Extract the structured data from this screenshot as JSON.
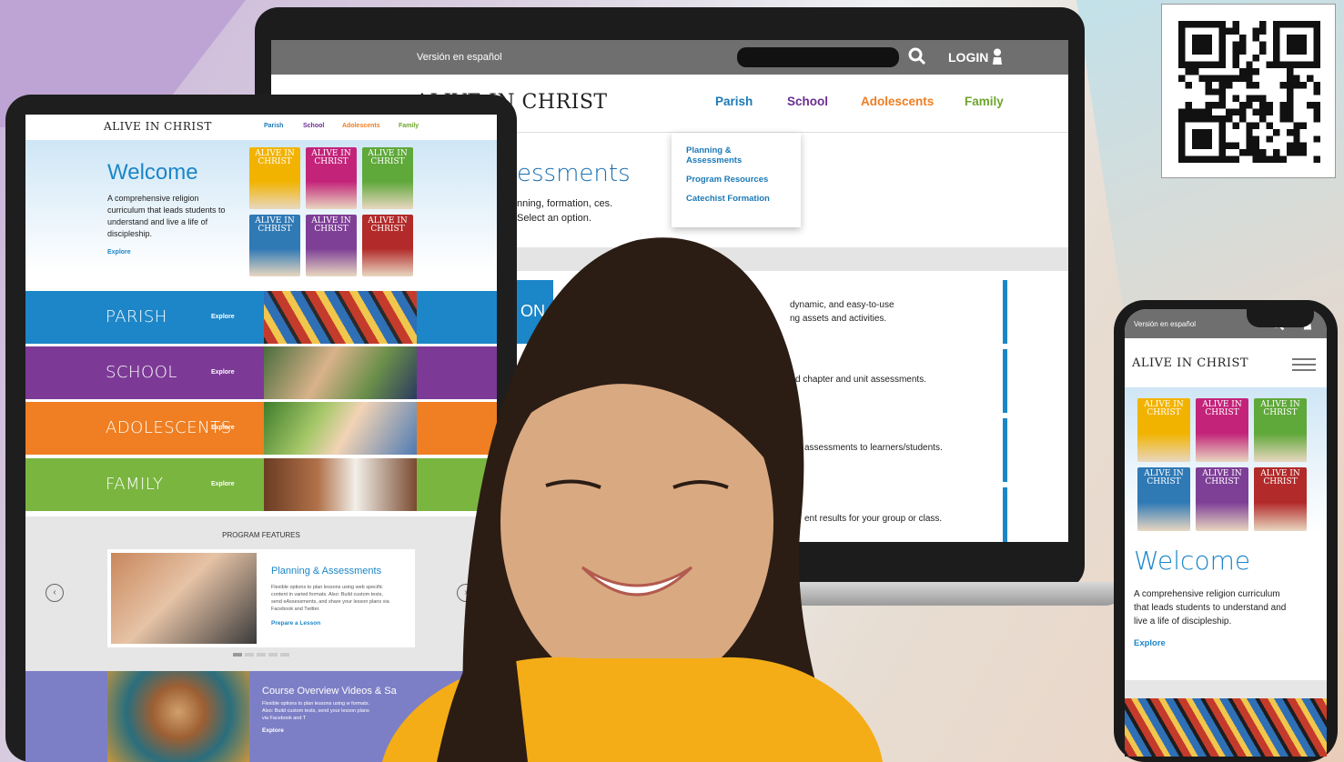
{
  "laptop": {
    "top_bar": {
      "spanish_link": "Versión en español",
      "login_label": "LOGIN"
    },
    "nav": {
      "logo": "ALIVE IN CHRIST",
      "items": [
        {
          "label": "Parish",
          "color": "#1b79b7"
        },
        {
          "label": "School",
          "color": "#6b2d91"
        },
        {
          "label": "Adolescents",
          "color": "#ee7d22"
        },
        {
          "label": "Family",
          "color": "#6fa52e"
        }
      ]
    },
    "dropdown": [
      "Planning & Assessments",
      "Program Resources",
      "Catechist Formation"
    ],
    "hero": {
      "title": "essments",
      "desc": "nning, formation, ces. Select an option."
    },
    "row_label": "ON",
    "list_text": [
      "dynamic, and easy-to-use",
      "ng assets and activities.",
      "d chapter and unit assessments.",
      "assessments to learners/students.",
      "ent results for your group or class."
    ]
  },
  "tablet": {
    "nav": {
      "logo": "ALIVE IN CHRIST",
      "items": [
        {
          "label": "Parish",
          "color": "#1b79b7"
        },
        {
          "label": "School",
          "color": "#6b2d91"
        },
        {
          "label": "Adolescents",
          "color": "#ee7d22"
        },
        {
          "label": "Family",
          "color": "#6fa52e"
        }
      ]
    },
    "hero": {
      "title": "Welcome",
      "desc": "A comprehensive religion curriculum that leads students to understand and live a life of discipleship.",
      "explore": "Explore"
    },
    "book_label": "ALIVE IN CHRIST",
    "book_colors": [
      "#f2b300",
      "#c3247a",
      "#5fa83a",
      "#2f79b5",
      "#7e3f97",
      "#b22a2a"
    ],
    "sections": [
      {
        "label": "PARISH",
        "explore": "Explore",
        "color": "#1d86c8"
      },
      {
        "label": "SCHOOL",
        "explore": "Explore",
        "color": "#7c3a96"
      },
      {
        "label": "ADOLESCENTS",
        "explore": "Explore",
        "color": "#ef7f22"
      },
      {
        "label": "FAMILY",
        "explore": "Explore",
        "color": "#7ab540"
      }
    ],
    "features": {
      "heading": "PROGRAM FEATURES",
      "card_title": "Planning & Assessments",
      "card_desc": "Flexible options to plan lessons using web specific content in varied formats. Also: Build custom tests, send eAssessments, and share your lesson plans via Facebook and Twitter.",
      "card_link": "Prepare a Lesson",
      "prev": "‹",
      "next": "›"
    },
    "bottom": {
      "title": "Course Overview Videos & Sa",
      "desc": "Flexible options to plan lessons using w formats. Also: Build custom tests, send your lesson plans via Facebook and T",
      "explore": "Explore"
    }
  },
  "phone": {
    "top_bar": {
      "spanish_link": "Versión en español"
    },
    "logo": "ALIVE IN CHRIST",
    "welcome": "Welcome",
    "desc": "A comprehensive religion curriculum that leads students to understand and live a life of discipleship.",
    "explore": "Explore"
  }
}
